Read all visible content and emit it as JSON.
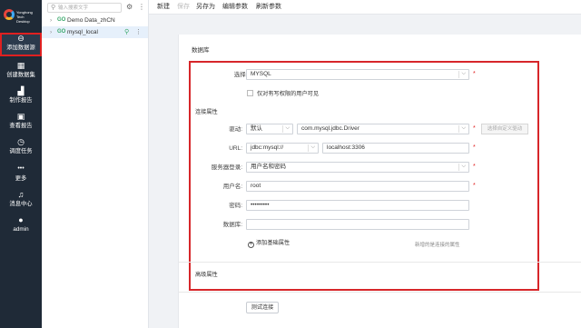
{
  "nav": {
    "logo_text_1": "Yonghong Tech",
    "logo_text_2": "Desktop",
    "items": [
      {
        "label": "添加数据源",
        "icon": "link-icon",
        "glyph": "⊖",
        "active": true
      },
      {
        "label": "创建数据集",
        "icon": "dataset-icon",
        "glyph": "▦",
        "active": false
      },
      {
        "label": "制作报告",
        "icon": "bar-chart-icon",
        "glyph": "▟",
        "active": false
      },
      {
        "label": "查看报告",
        "icon": "view-report-icon",
        "glyph": "▣",
        "active": false
      },
      {
        "label": "调度任务",
        "icon": "clock-icon",
        "glyph": "◷",
        "active": false
      },
      {
        "label": "更多",
        "icon": "more-icon",
        "glyph": "•••",
        "active": false
      },
      {
        "label": "消息中心",
        "icon": "bell-icon",
        "glyph": "♫",
        "active": false
      },
      {
        "label": "admin",
        "icon": "user-icon",
        "glyph": "●",
        "active": false
      }
    ]
  },
  "tree": {
    "search_placeholder": "输入搜索文字",
    "items": [
      {
        "badge": "GO",
        "name": "Demo Data_zhCN",
        "selected": false
      },
      {
        "badge": "GO",
        "name": "mysql_local",
        "selected": true
      }
    ]
  },
  "toolbar": {
    "new": "新建",
    "save": "保存",
    "save_as": "另存为",
    "edit_params": "编辑参数",
    "refresh_params": "刷新参数"
  },
  "form": {
    "db_section": "数据库",
    "db_type_label": "选择数据源:",
    "db_type_value": "MYSQL",
    "perm_check_label": "仅对有写权限的用户可见",
    "conn_section": "连接属性",
    "driver_label": "驱动:",
    "driver_mode": "默认",
    "driver_class": "com.mysql.jdbc.Driver",
    "custom_driver_btn": "选择自定义驱动",
    "url_label": "URL:",
    "url_prefix": "jdbc:mysql://",
    "url_host": "localhost:3306",
    "login_label": "服务器登录:",
    "login_value": "用户名和密码",
    "user_label": "用户名:",
    "user_value": "root",
    "password_label": "密码:",
    "password_value": "•••••••••",
    "database_label": "数据库:",
    "database_value": "",
    "add_prop": "添加基础属性",
    "add_prop_hint": "新增的是连接的属性",
    "advanced_section": "高级属性",
    "test_btn": "测试连接",
    "required_mark": "*"
  },
  "colors": {
    "nav_bg": "#1f2a37",
    "highlight_red": "#d7262a",
    "go_green": "#3aa86b"
  }
}
